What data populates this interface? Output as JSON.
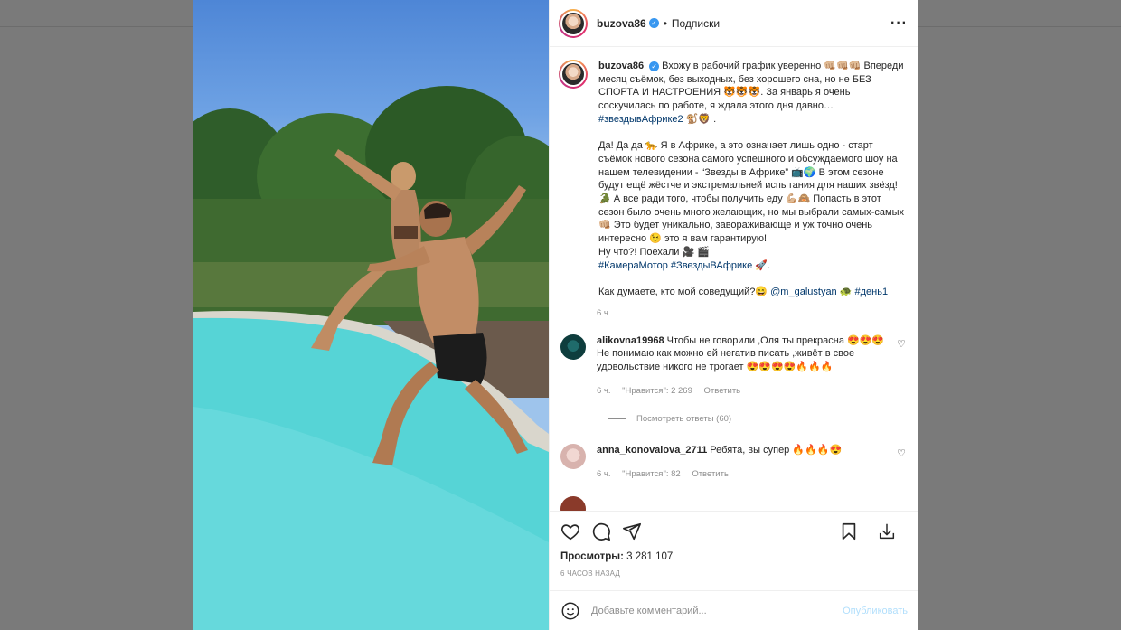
{
  "post": {
    "username": "buzova86",
    "follow_status": "Подписки",
    "caption_user": "buzova86",
    "caption_lines": [
      "Вхожу в рабочий график уверенно 👊🏼👊🏼👊🏼 Впереди месяц съёмок, без выходных, без хорошего сна, но не БЕЗ СПОРТА И НАСТРОЕНИЯ 🐯🐯🐯. За январь я очень соскучилась по работе, я ждала этого дня давно… "
    ],
    "caption_tag1": "#звездывАфрике2",
    "caption_tag1_after": " 🐒🦁 .",
    "caption_p2": "Да! Да да 🐆 Я в Африке, а это означает лишь одно - старт съёмок нового сезона самого успешного и обсуждаемого шоу на нашем телевидении - “Звезды в Африке” 📺🌍 В этом сезоне будут ещё жёстче и экстремальней испытания для наших звёзд! 🐊 А все ради того, чтобы получить еду 💪🏼🙈 Попасть в этот сезон было очень много желающих, но мы выбрали самых-самых 👊🏼 Это будет уникально, завораживающе и уж точно очень интересно 😉 это я вам гарантирую!",
    "caption_p3": "Ну что?! Поехали 🎥 🎬",
    "caption_tags2": "#КамераМотор #ЗвездыВАфрике",
    "caption_tags2_after": " 🚀.",
    "caption_q": "Как думаете, кто мой соведущий?😄 ",
    "caption_mention": "@m_galustyan",
    "caption_q_mid": " 🐢 ",
    "caption_q_tag": "#день1",
    "caption_time": "6 ч.",
    "views_label": "Просмотры:",
    "views_value": "3 281 107",
    "posted_ago": "6 ЧАСОВ НАЗАД"
  },
  "comments": [
    {
      "user": "alikovna19968",
      "text": "Чтобы не говорили ,Оля ты прекрасна 😍😍😍Не понимаю как можно ей негатив писать ,живёт в свое удовольствие никого не трогает 😍😍😍😍🔥🔥🔥",
      "time": "6 ч.",
      "likes": "\"Нравится\": 2 269",
      "reply": "Ответить",
      "view_replies": "Посмотреть ответы (60)"
    },
    {
      "user": "anna_konovalova_2711",
      "text": "Ребята, вы супер 🔥🔥🔥😍",
      "time": "6 ч.",
      "likes": "\"Нравится\": 82",
      "reply": "Ответить"
    }
  ],
  "compose": {
    "placeholder": "Добавьте комментарий...",
    "publish": "Опубликовать"
  },
  "icons": {
    "like": "heart-icon",
    "comment": "comment-icon",
    "share": "paper-plane-icon",
    "save": "bookmark-icon",
    "download": "download-icon",
    "more": "more-icon",
    "emoji": "emoji-icon"
  },
  "colors": {
    "link": "#00376b",
    "verified": "#3897f0",
    "publish_disabled": "#b2dffc",
    "muted": "#8e8e8e"
  }
}
